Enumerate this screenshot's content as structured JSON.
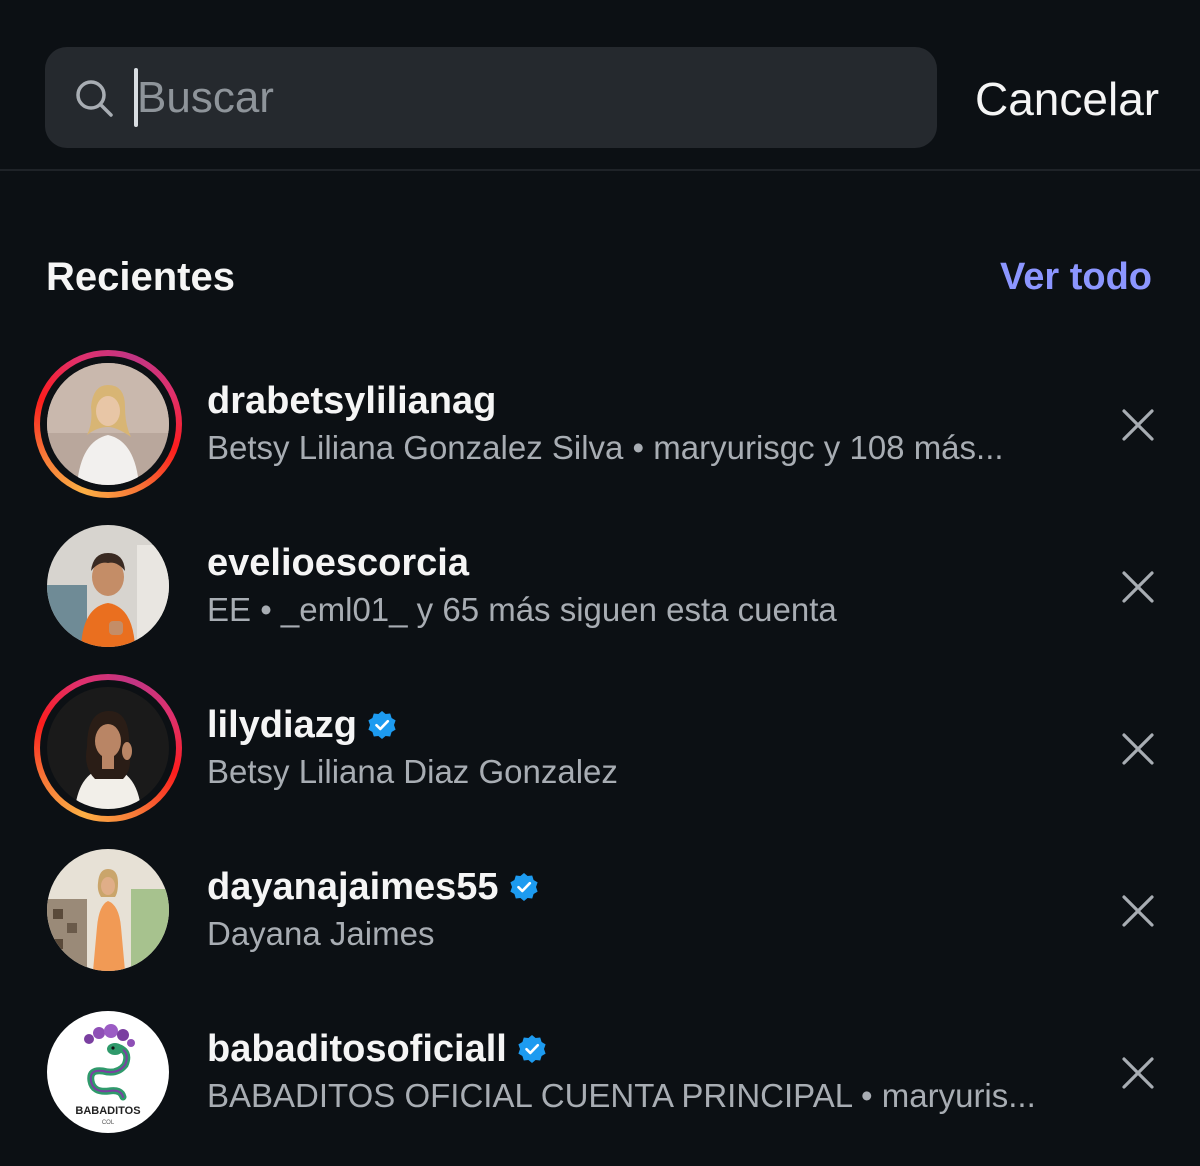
{
  "search": {
    "placeholder": "Buscar",
    "value": "",
    "cancel_label": "Cancelar",
    "icon": "search-icon"
  },
  "recent": {
    "title": "Recientes",
    "see_all_label": "Ver todo",
    "items": [
      {
        "username": "drabetsylilianag",
        "subtitle": "Betsy Liliana Gonzalez Silva • maryurisgc y 108 más...",
        "verified": false,
        "story_ring": true
      },
      {
        "username": "evelioescorcia",
        "subtitle": "EE • _eml01_ y 65 más siguen esta cuenta",
        "verified": false,
        "story_ring": false
      },
      {
        "username": "lilydiazg",
        "subtitle": "Betsy Liliana Diaz Gonzalez",
        "verified": true,
        "story_ring": true
      },
      {
        "username": "dayanajaimes55",
        "subtitle": "Dayana Jaimes",
        "verified": true,
        "story_ring": false
      },
      {
        "username": "babaditosoficiall",
        "subtitle": "BABADITOS OFICIAL CUENTA PRINCIPAL • maryuris...",
        "verified": true,
        "story_ring": false,
        "logo_text": "BABADITOS",
        "logo_subtext": "COL"
      }
    ]
  },
  "colors": {
    "background": "#0c1014",
    "search_field": "#25292e",
    "link_accent": "#8c96ff",
    "verified_blue": "#1d9bf0",
    "secondary_text": "#a8adb3"
  }
}
